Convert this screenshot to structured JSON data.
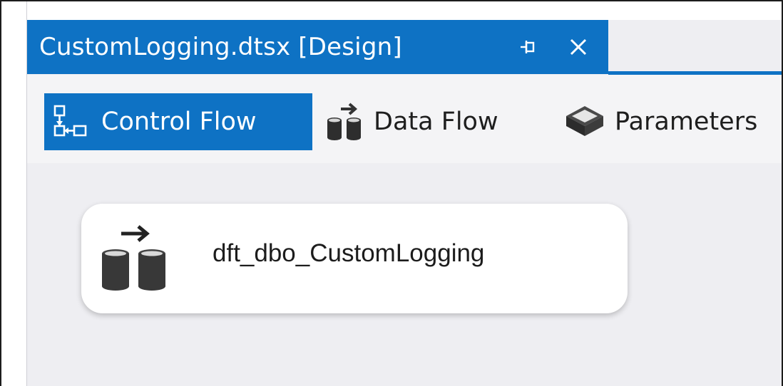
{
  "document_tab": {
    "title": "CustomLogging.dtsx [Design]",
    "pin_icon": "pin-icon",
    "close_icon": "close-icon",
    "accent_color": "#0e72c4"
  },
  "designer_tabs": [
    {
      "label": "Control Flow",
      "icon": "control-flow-icon",
      "active": true
    },
    {
      "label": "Data Flow",
      "icon": "data-flow-icon",
      "active": false
    },
    {
      "label": "Parameters",
      "icon": "parameters-icon",
      "active": false
    }
  ],
  "canvas": {
    "tasks": [
      {
        "label": "dft_dbo_CustomLogging",
        "icon": "data-flow-task-icon"
      }
    ]
  }
}
